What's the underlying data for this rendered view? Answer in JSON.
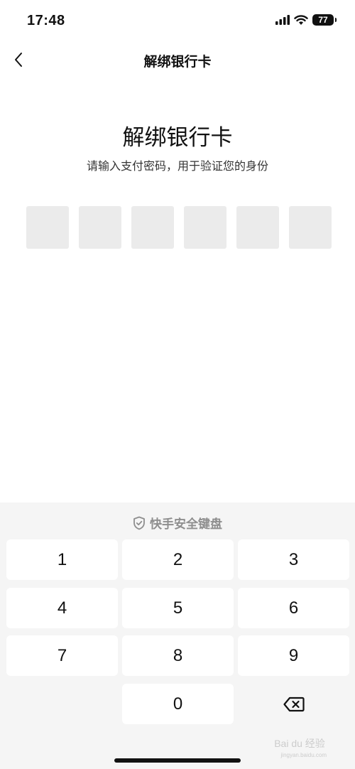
{
  "status": {
    "time": "17:48",
    "battery": "77"
  },
  "nav": {
    "title": "解绑银行卡"
  },
  "main": {
    "heading": "解绑银行卡",
    "subtitle": "请输入支付密码，用于验证您的身份",
    "pin_length": 6
  },
  "keyboard": {
    "label": "快手安全键盘",
    "keys": [
      "1",
      "2",
      "3",
      "4",
      "5",
      "6",
      "7",
      "8",
      "9",
      "0"
    ]
  },
  "watermark": {
    "text": "Bai du 经验",
    "sub": "jingyan.baidu.com"
  },
  "icons": {
    "back": "chevron-left-icon",
    "signal": "signal-bars-icon",
    "wifi": "wifi-icon",
    "battery": "battery-icon",
    "shield": "shield-check-icon",
    "backspace": "backspace-icon"
  }
}
